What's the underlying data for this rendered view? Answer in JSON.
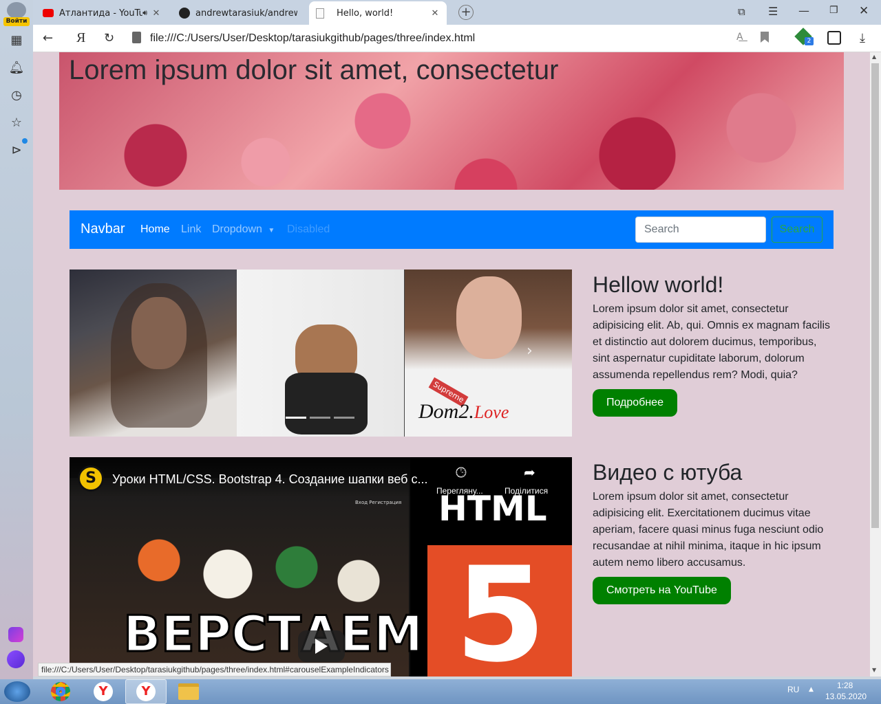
{
  "browser": {
    "login_label": "Войти",
    "tabs": [
      {
        "label": "Атлантида - YouTub",
        "icon": "youtube-icon"
      },
      {
        "label": "andrewtarasiuk/andrewtara",
        "icon": "github-icon"
      },
      {
        "label": "Hello, world!",
        "icon": "page-icon",
        "active": true
      }
    ],
    "address": "file:///C:/Users/User/Desktop/tarasiukgithub/pages/three/index.html",
    "badge_count": "2",
    "status_url": "file:///C:/Users/User/Desktop/tarasiukgithub/pages/three/index.html#carouselExampleIndicators"
  },
  "hero": {
    "title": "Lorem ipsum dolor sit amet, consectetur"
  },
  "navbar": {
    "brand": "Navbar",
    "links": [
      "Home",
      "Link",
      "Dropdown",
      "Disabled"
    ],
    "search_placeholder": "Search",
    "search_button": "Search"
  },
  "section1": {
    "heading": "Hellow world!",
    "text": "Lorem ipsum dolor sit amet, consectetur adipisicing elit. Ab, qui. Omnis ex magnam facilis et distinctio aut dolorem ducimus, temporibus, sint aspernatur cupiditate laborum, dolorum assumenda repellendus rem? Modi, quia?",
    "button": "Подробнее"
  },
  "carousel": {
    "slide3_caption": "Dom2.",
    "slide3_caption_red": "Love",
    "shirt_text": "Supreme"
  },
  "section2": {
    "heading": "Видео с ютуба",
    "text": "Lorem ipsum dolor sit amet, consectetur adipisicing elit. Exercitationem ducimus vitae aperiam, facere quasi minus fuga nesciunt odio recusandae at nihil minima, itaque in hic ipsum autem nemo libero accusamus.",
    "button": "Смотреть на YouTube"
  },
  "video": {
    "title": "Уроки HTML/CSS. Bootstrap 4. Создание шапки веб с...",
    "watch_later": "Перегляну...",
    "share": "Поділитися",
    "overlay_text": "ВЕРСТАЕМ",
    "big_text": "HTML",
    "five": "5",
    "inner_links": "Вход  Регистрация"
  },
  "taskbar": {
    "lang": "RU",
    "time": "1:28",
    "date": "13.05.2020"
  },
  "colors": {
    "navbar": "#007bff",
    "button": "#008000",
    "page_bg": "#e0cdd7"
  }
}
